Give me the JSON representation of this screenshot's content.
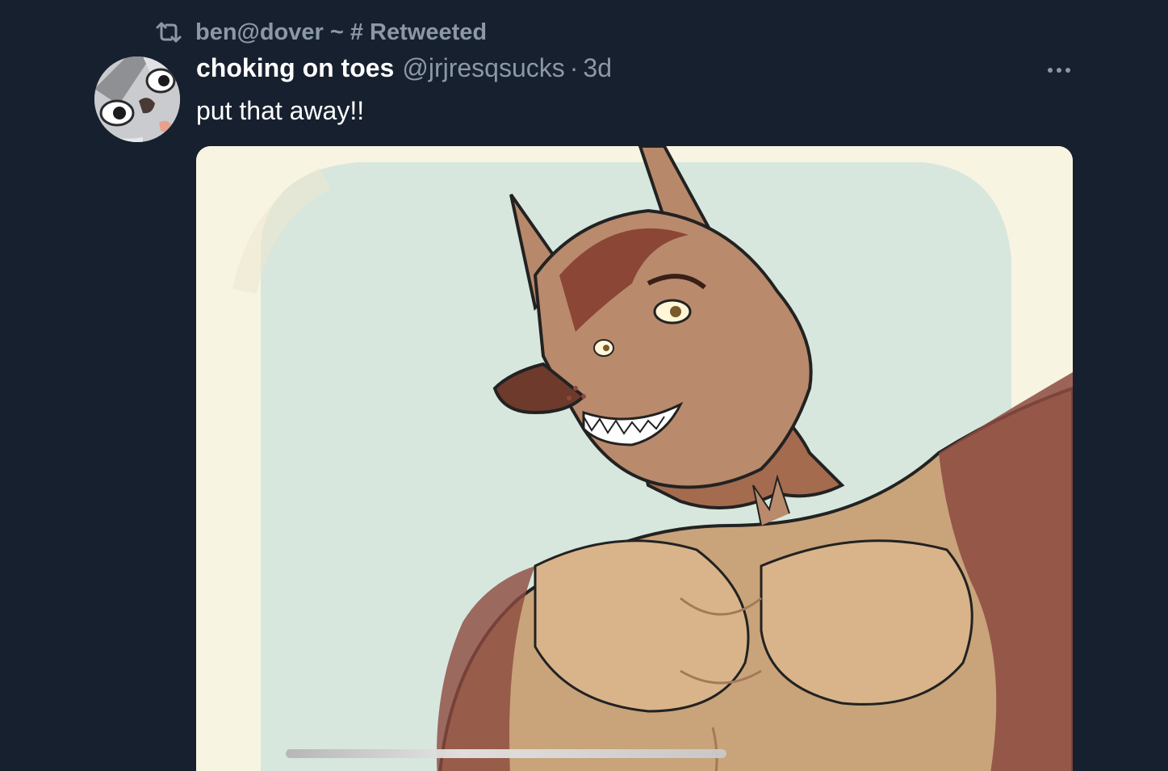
{
  "retweet": {
    "icon": "retweet-icon",
    "label": "ben@dover ~ # Retweeted"
  },
  "tweet": {
    "display_name": "choking on toes",
    "handle": "@jrjresqsucks",
    "separator": "·",
    "time": "3d",
    "text": "put that away!!",
    "more_icon": "more-horizontal-icon",
    "media_alt": "illustration of a smirking brown wolf character"
  },
  "colors": {
    "background": "#17202e",
    "secondary_text": "#8b98a5",
    "primary_text": "#ffffff"
  }
}
